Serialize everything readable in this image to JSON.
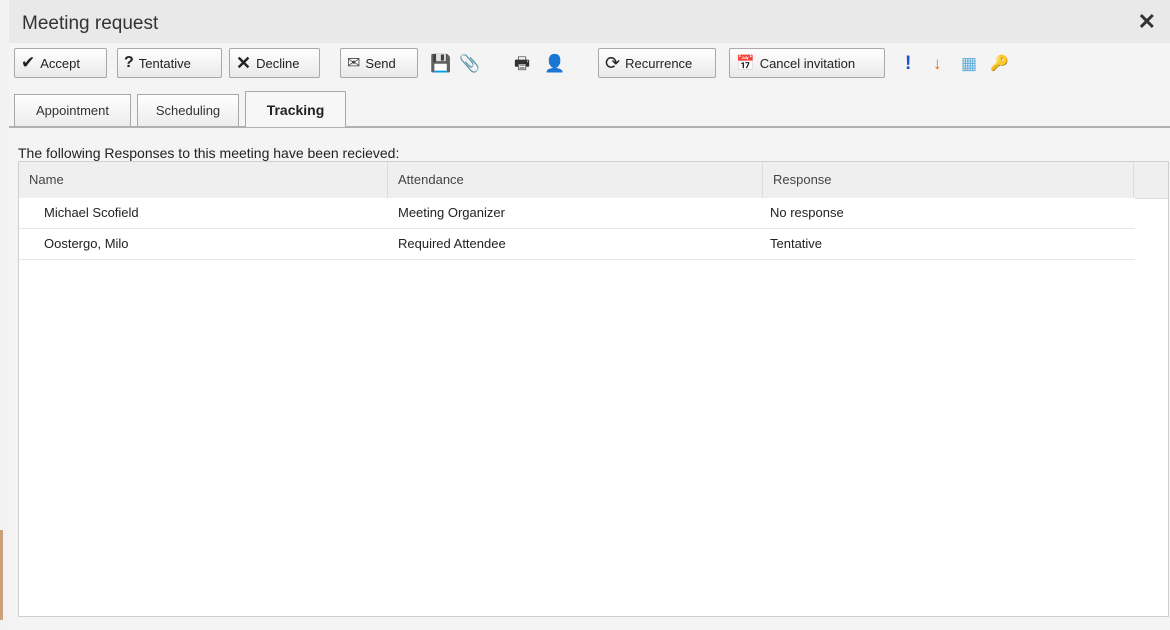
{
  "window": {
    "title": "Meeting request",
    "close_glyph": "✕"
  },
  "toolbar": {
    "accept": {
      "label": "Accept",
      "icon": "checkmark-icon",
      "glyph": "✔"
    },
    "tentative": {
      "label": "Tentative",
      "icon": "question-icon",
      "glyph": "?"
    },
    "decline": {
      "label": "Decline",
      "icon": "x-icon",
      "glyph": "✕"
    },
    "send": {
      "label": "Send",
      "icon": "envelope-icon",
      "glyph": "✉"
    },
    "save_glyph": "💾",
    "attach_glyph": "📎",
    "print_glyph": "🖶",
    "check_names_glyph": "👤",
    "recurrence": {
      "label": "Recurrence",
      "icon": "recurrence-icon",
      "glyph": "⟳"
    },
    "cancel_invitation": {
      "label": "Cancel invitation",
      "icon": "calendar-cancel-icon",
      "glyph": "📅"
    },
    "high_importance_glyph": "!",
    "low_importance_glyph": "↓",
    "categories_glyph": "▦",
    "private_glyph": "🔑",
    "colors": {
      "high_importance": "#1f4fd6",
      "low_importance": "#e06a1a",
      "categories": "#5aa9d8",
      "check_names": "#3ca03c"
    }
  },
  "tabs": [
    {
      "label": "Appointment",
      "active": false
    },
    {
      "label": "Scheduling",
      "active": false
    },
    {
      "label": "Tracking",
      "active": true
    }
  ],
  "tracking": {
    "caption": "The following Responses to this meeting have been recieved:",
    "columns": [
      "Name",
      "Attendance",
      "Response"
    ],
    "rows": [
      {
        "name": "Michael Scofield",
        "attendance": "Meeting Organizer",
        "response": "No response"
      },
      {
        "name": "Oostergo, Milo",
        "attendance": "Required Attendee",
        "response": "Tentative"
      }
    ]
  }
}
